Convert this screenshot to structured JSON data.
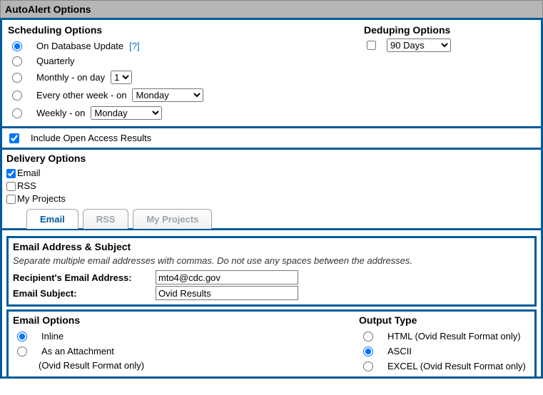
{
  "panel_title": "AutoAlert Options",
  "scheduling": {
    "heading": "Scheduling Options",
    "on_db_update": "On Database Update",
    "help_q": "[?]",
    "quarterly": "Quarterly",
    "monthly_prefix": "Monthly - on day",
    "monthly_day_selected": "1",
    "eow_prefix": "Every other week - on",
    "eow_day_selected": "Monday",
    "weekly_prefix": "Weekly - on",
    "weekly_day_selected": "Monday"
  },
  "deduping": {
    "heading": "Deduping Options",
    "selected": "90 Days"
  },
  "open_access": {
    "label": "Include Open Access Results"
  },
  "delivery": {
    "heading": "Delivery Options",
    "email": "Email",
    "rss": "RSS",
    "my_projects": "My Projects",
    "tab_email": "Email",
    "tab_rss": "RSS",
    "tab_my_projects": "My Projects"
  },
  "email_section": {
    "heading": "Email Address & Subject",
    "hint": "Separate multiple email addresses with commas. Do not use any spaces between the addresses.",
    "recipient_label": "Recipient's Email Address:",
    "recipient_value": "mto4@cdc.gov",
    "subject_label": "Email Subject:",
    "subject_value": "Ovid Results"
  },
  "email_options": {
    "heading": "Email Options",
    "inline": "Inline",
    "attachment": "As an Attachment",
    "attachment_note": "(Ovid Result Format only)"
  },
  "output_type": {
    "heading": "Output Type",
    "html": "HTML (Ovid Result Format only)",
    "ascii": "ASCII",
    "excel": "EXCEL (Ovid Result Format only)"
  }
}
